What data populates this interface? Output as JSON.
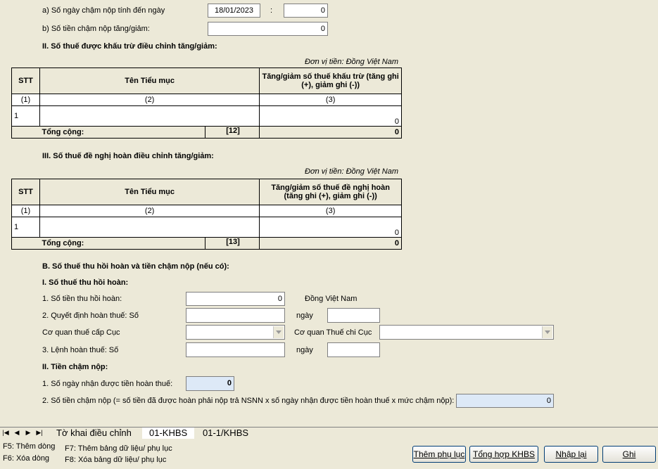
{
  "top": {
    "a_label": "a) Số ngày chậm nộp tính đến ngày",
    "a_date": "18/01/2023",
    "a_colon": ":",
    "a_days": "0",
    "b_label": "b) Số tiền chậm nộp tăng/giảm:",
    "b_value": "0"
  },
  "section2": {
    "title": "II. Số thuế được khấu trừ điều chỉnh tăng/giảm:",
    "unit": "Đơn vị tiền: Đồng Việt Nam",
    "headers": [
      "STT",
      "Tên Tiểu mục",
      "Tăng/giảm số thuế khấu trừ (tăng ghi (+), giảm ghi (-))"
    ],
    "nums": [
      "(1)",
      "(2)",
      "(3)"
    ],
    "row": {
      "stt": "1",
      "name": "",
      "value": "0"
    },
    "total_label": "Tổng cộng:",
    "total_code": "[12]",
    "total_value": "0"
  },
  "section3": {
    "title": "III. Số thuế đề nghị hoàn điều chỉnh tăng/giảm:",
    "unit": "Đơn vị tiền: Đồng Việt Nam",
    "headers": [
      "STT",
      "Tên Tiểu mục",
      "Tăng/giảm số thuế đề nghị hoàn (tăng ghi (+), giảm ghi (-))"
    ],
    "nums": [
      "(1)",
      "(2)",
      "(3)"
    ],
    "row": {
      "stt": "1",
      "name": "",
      "value": "0"
    },
    "total_label": "Tổng cộng:",
    "total_code": "[13]",
    "total_value": "0"
  },
  "sectionB": {
    "title": "B. Số thuế thu hồi hoàn và tiền chậm nộp (nếu có):",
    "sub1": "I. Số thuế thu hồi hoàn:",
    "l1": "1. Số tiền thu hồi hoàn:",
    "v1": "0",
    "unit1": "Đồng Việt Nam",
    "l2": "2. Quyết định hoàn thuế: Số",
    "ngay": "ngày",
    "l_cuc": "Cơ quan thuế cấp Cục",
    "l_chicuc": "Cơ quan Thuế chi Cục",
    "l3": "3. Lệnh hoàn thuế: Số",
    "sub2": "II. Tiền chậm nộp:",
    "l4": "1. Số ngày nhận được tiền hoàn thuế:",
    "v4": "0",
    "l5": "2. Số tiền chậm nộp (= số tiền đã được hoàn phải nộp trả NSNN x số ngày nhận được tiền hoàn thuế x mức chậm nộp):",
    "v5": "0"
  },
  "tabs": [
    "Tờ khai điều chỉnh",
    "01-KHBS",
    "01-1/KHBS"
  ],
  "nav": [
    "|◀",
    "◀",
    "▶",
    "▶|"
  ],
  "fkeys": {
    "f5": "F5: Thêm dòng",
    "f6": "F6: Xóa dòng",
    "f7": "F7: Thêm bảng dữ liệu/ phụ lục",
    "f8": "F8: Xóa bảng dữ liệu/ phụ lục"
  },
  "buttons": {
    "add_appendix": "Thêm phụ lục",
    "summary": "Tổng hợp KHBS",
    "reset": "Nhập lại",
    "save": "Ghi"
  }
}
